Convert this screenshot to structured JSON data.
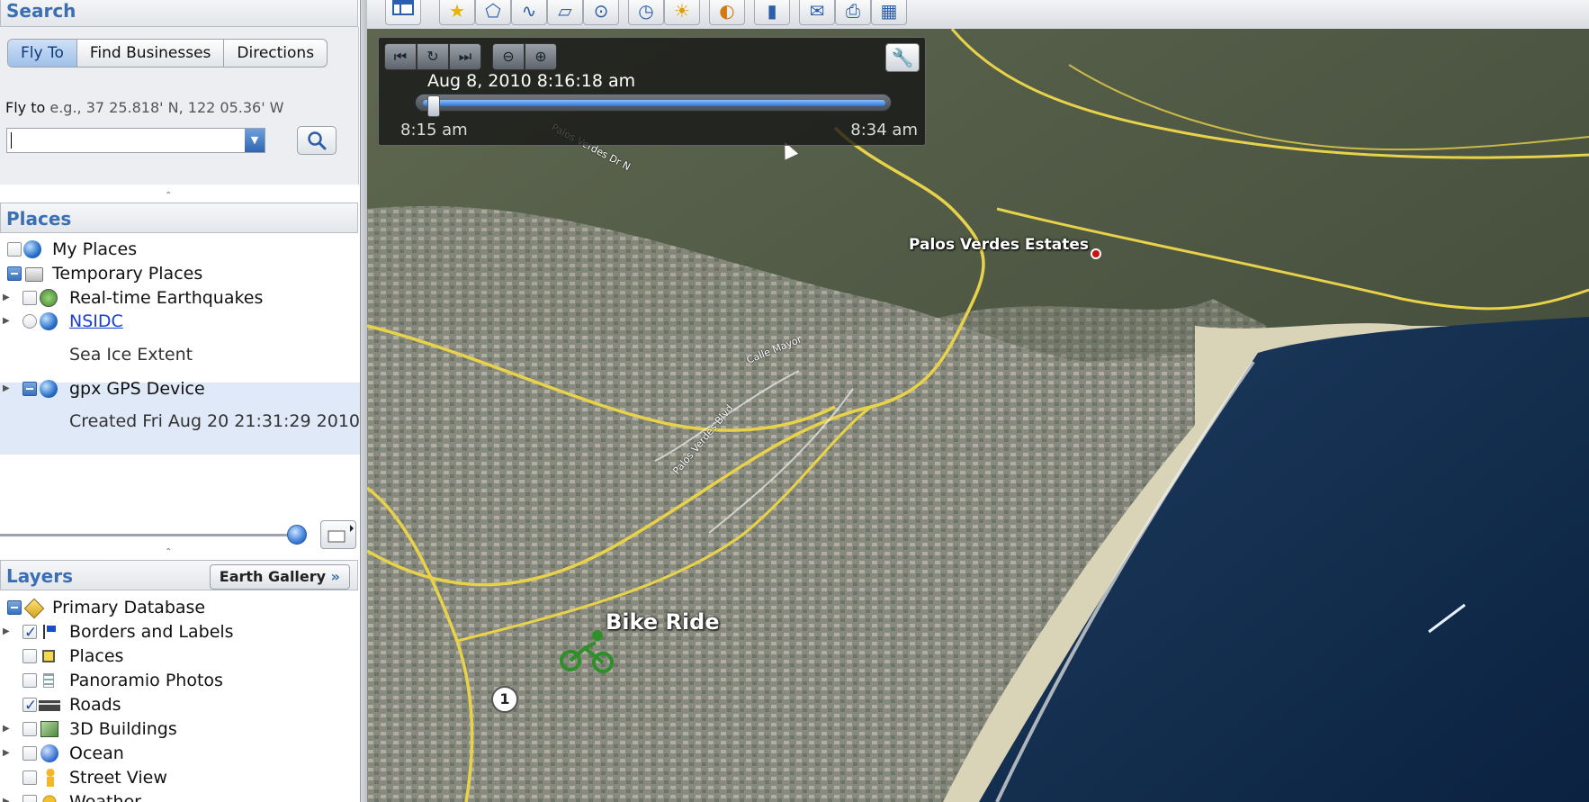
{
  "search": {
    "title": "Search",
    "tabs": [
      {
        "label": "Fly To"
      },
      {
        "label": "Find Businesses"
      },
      {
        "label": "Directions"
      }
    ],
    "flyto_label": "Fly to",
    "flyto_hint": "e.g., 37 25.818' N, 122 05.36' W",
    "query_value": ""
  },
  "places": {
    "title": "Places",
    "items": [
      {
        "label": "My Places"
      },
      {
        "label": "Temporary Places"
      },
      {
        "label": "Real-time Earthquakes"
      },
      {
        "label": "NSIDC"
      },
      {
        "label": "Sea Ice Extent"
      },
      {
        "label": "gpx GPS Device"
      },
      {
        "label": "Created Fri Aug 20 21:31:29 2010"
      }
    ]
  },
  "layers": {
    "title": "Layers",
    "gallery_label": "Earth Gallery",
    "gallery_chevron": "»",
    "items": [
      {
        "label": "Primary Database"
      },
      {
        "label": "Borders and Labels"
      },
      {
        "label": "Places"
      },
      {
        "label": "Panoramio Photos"
      },
      {
        "label": "Roads"
      },
      {
        "label": "3D Buildings"
      },
      {
        "label": "Ocean"
      },
      {
        "label": "Street View"
      },
      {
        "label": "Weather"
      }
    ]
  },
  "timeslider": {
    "current": "Aug  8, 2010   8:16:18 am",
    "start": "8:15 am",
    "end": "8:34 am",
    "position": 0.02
  },
  "map": {
    "labels": {
      "town": "Palos Verdes Estates",
      "route": "Bike Ride",
      "road1": "Palos Verdes Dr N",
      "road2": "Calle Mayor",
      "road3": "Palos Verdes Blvd",
      "shield": "1"
    }
  },
  "colors": {
    "accent": "#3a6fb3",
    "selection": "#dfe9f7",
    "ocean": "#0e2a4e",
    "road": "#e8d24a"
  },
  "icons": {
    "toolbar": [
      "sidebar-icon",
      "placemark-icon",
      "polygon-icon",
      "path-icon",
      "image-overlay-icon",
      "record-tour-icon",
      "historical-imagery-icon",
      "sunlight-icon",
      "planets-icon",
      "ruler-icon",
      "email-icon",
      "print-icon",
      "google-maps-icon"
    ]
  }
}
